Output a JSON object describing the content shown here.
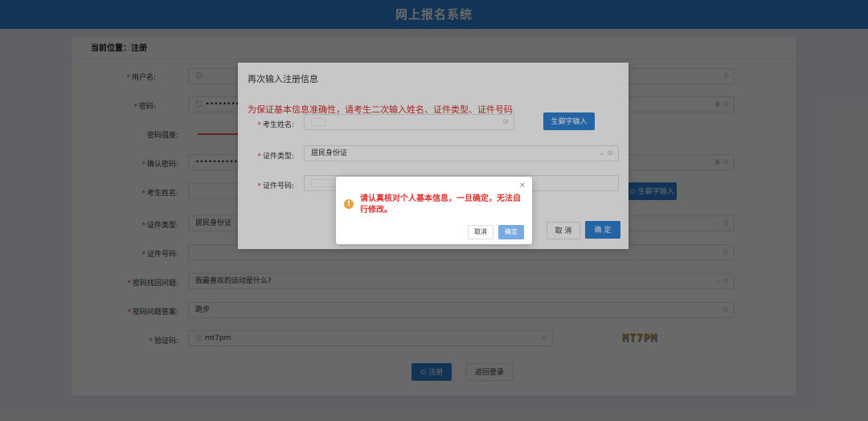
{
  "header": {
    "title": "网上报名系统"
  },
  "page": {
    "breadcrumb": "当前位置：注册"
  },
  "form": {
    "username_label": "用户名:",
    "password_label": "密码:",
    "password_value": "••••••••••",
    "strength_label": "密码强度:",
    "confirm_label": "确认密码:",
    "confirm_value": "••••••••••",
    "name_label": "考生姓名:",
    "rare_char_button": "生僻字输入",
    "id_type_label": "证件类型:",
    "id_type_value": "居民身份证",
    "id_number_label": "证件号码:",
    "question_label": "密码找回问题:",
    "question_value": "我最喜欢的运动是什么?",
    "answer_label": "密码问题答案:",
    "answer_value": "跑步",
    "captcha_label": "验证码:",
    "captcha_value": "mt7pm",
    "captcha_image_text": "MT7PM",
    "register_button": "注册",
    "back_button": "返回登录"
  },
  "dialog": {
    "title": "再次输入注册信息",
    "notice": "为保证基本信息准确性，请考生二次输入姓名、证件类型、证件号码",
    "name_label": "考生姓名:",
    "rare_char_button": "生僻字输入",
    "id_type_label": "证件类型:",
    "id_type_value": "居民身份证",
    "id_number_label": "证件号码:",
    "cancel_button": "取 消",
    "ok_button": "确 定"
  },
  "confirm": {
    "message": "请认真核对个人基本信息，一旦确定，无法自行修改。",
    "cancel_button": "取消",
    "ok_button": "确定"
  },
  "colors": {
    "brand": "#2f7fd3",
    "warning": "#e6a23c",
    "error": "#e0332d"
  }
}
